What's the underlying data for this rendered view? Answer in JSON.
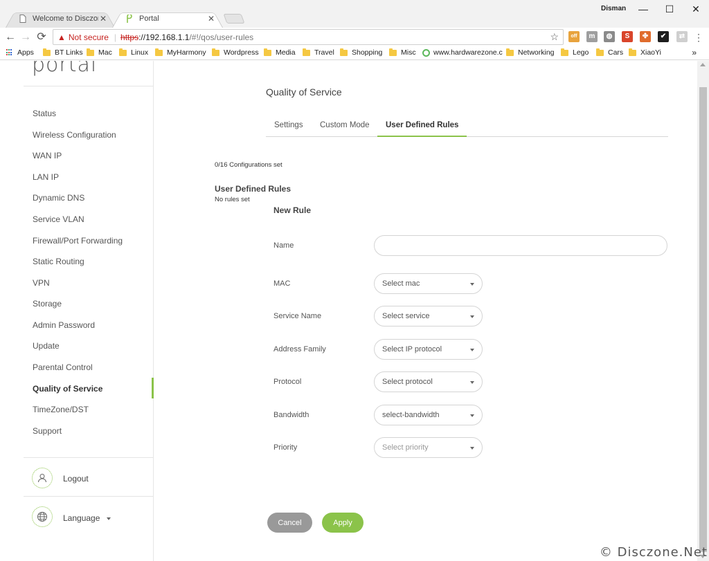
{
  "browser": {
    "tabs": [
      {
        "label": "Welcome to Disczone! - ",
        "close": "✕"
      },
      {
        "label": "Portal",
        "close": "✕"
      }
    ],
    "window_user": "Disman",
    "window_controls": {
      "minimize": "—",
      "maximize": "☐",
      "close": "✕"
    },
    "nav": {
      "back": "←",
      "forward": "→",
      "reload": "⟳"
    },
    "address": {
      "security_text": "Not secure",
      "scheme": "https",
      "host": "://192.168.1.1",
      "path": "/#!/qos/user-rules"
    },
    "extensions": [
      {
        "name": "script-icon",
        "color": "#e8a33d",
        "glyph": "off"
      },
      {
        "name": "gray-extension-icon",
        "color": "#9e9e9e",
        "glyph": "m"
      },
      {
        "name": "ghost-extension-icon",
        "color": "#8a8a8a",
        "glyph": "◍"
      },
      {
        "name": "s-extension-icon",
        "color": "#d9452b",
        "glyph": "S"
      },
      {
        "name": "clover-extension-icon",
        "color": "#e06c2d",
        "glyph": "✤"
      },
      {
        "name": "check-extension-icon",
        "color": "#1d1d1d",
        "glyph": "✔"
      },
      {
        "name": "cast-icon",
        "color": "#cfcfcf",
        "glyph": "⇄"
      }
    ],
    "menu": "⋮",
    "bookmarks": [
      "Apps",
      "BT Links",
      "Mac",
      "Linux",
      "MyHarmony",
      "Wordpress",
      "Media",
      "Travel",
      "Shopping",
      "Misc",
      "www.hardwarezone.c",
      "Networking",
      "Lego",
      "Cars",
      "XiaoYi"
    ],
    "bookmarks_more": "»"
  },
  "sidebar": {
    "logo": "portal",
    "items": [
      "Status",
      "Wireless Configuration",
      "WAN IP",
      "LAN IP",
      "Dynamic DNS",
      "Service VLAN",
      "Firewall/Port Forwarding",
      "Static Routing",
      "VPN",
      "Storage",
      "Admin Password",
      "Update",
      "Parental Control",
      "Quality of Service",
      "TimeZone/DST",
      "Support"
    ],
    "active_item": "Quality of Service",
    "logout": "Logout",
    "language": "Language"
  },
  "main": {
    "title": "Quality of Service",
    "tabs": [
      "Settings",
      "Custom Mode",
      "User Defined Rules"
    ],
    "active_tab": "User Defined Rules",
    "config_count": "0/16 Configurations set",
    "section_heading": "User Defined Rules",
    "no_rules": "No rules set",
    "new_rule": "New Rule",
    "fields": {
      "name_label": "Name",
      "name_value": "",
      "mac_label": "MAC",
      "mac_select": "Select mac",
      "service_label": "Service Name",
      "service_select": "Select service",
      "family_label": "Address Family",
      "family_select": "Select IP protocol",
      "protocol_label": "Protocol",
      "protocol_select": "Select protocol",
      "bandwidth_label": "Bandwidth",
      "bandwidth_select": "select-bandwidth",
      "priority_label": "Priority",
      "priority_select": "Select priority"
    },
    "cancel": "Cancel",
    "apply": "Apply"
  },
  "watermark": "© Disczone.Net",
  "colors": {
    "accent": "#8bc34a",
    "cancel_button": "#999999",
    "not_secure": "#c5221f"
  }
}
